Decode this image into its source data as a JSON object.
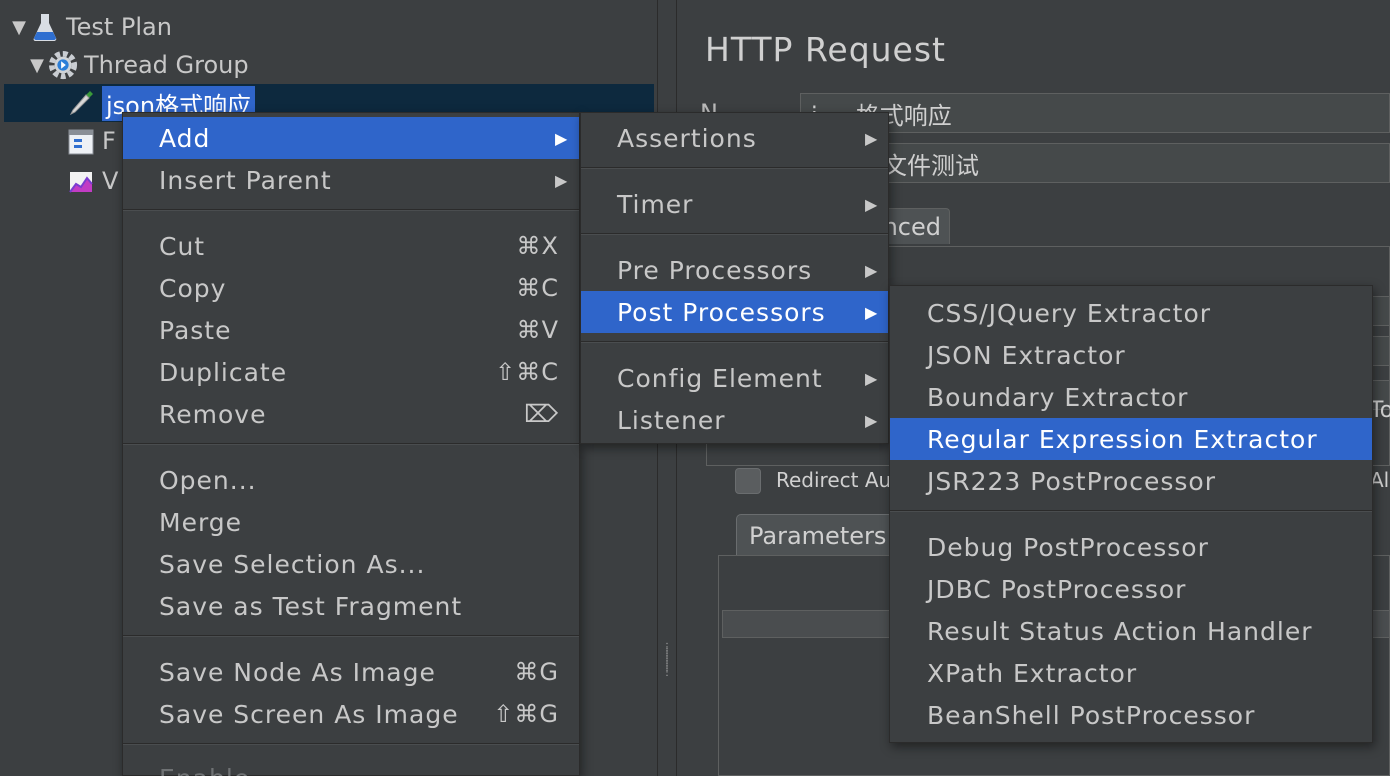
{
  "tree": {
    "test_plan": "Test Plan",
    "thread_group": "Thread Group",
    "selected_item": "json格式响应",
    "hidden_item_1": "F",
    "hidden_item_2": "V"
  },
  "http_request": {
    "title": "HTTP Request",
    "name_label": "N",
    "name_value": "j     格式响应",
    "comments_value": "取本地文件测试",
    "tab_advanced": "nced",
    "redirect_label": "Redirect Au",
    "keepalive_partial": "Ali",
    "to_partial": "To",
    "tab_parameters": "Parameters"
  },
  "context_menu": {
    "add": "Add",
    "insert_parent": "Insert Parent",
    "cut": "Cut",
    "cut_sc": "⌘X",
    "copy": "Copy",
    "copy_sc": "⌘C",
    "paste": "Paste",
    "paste_sc": "⌘V",
    "duplicate": "Duplicate",
    "duplicate_sc": "⇧⌘C",
    "remove": "Remove",
    "remove_sc": "⌦",
    "open": "Open...",
    "merge": "Merge",
    "save_selection_as": "Save Selection As...",
    "save_as_test_fragment": "Save as Test Fragment",
    "save_node_as_image": "Save Node As Image",
    "save_node_sc": "⌘G",
    "save_screen_as_image": "Save Screen As Image",
    "save_screen_sc": "⇧⌘G",
    "enable": "Enable"
  },
  "add_menu": {
    "assertions": "Assertions",
    "timer": "Timer",
    "pre_processors": "Pre Processors",
    "post_processors": "Post Processors",
    "config_element": "Config Element",
    "listener": "Listener"
  },
  "post_menu": {
    "css_jquery": "CSS/JQuery Extractor",
    "json": "JSON Extractor",
    "boundary": "Boundary Extractor",
    "regex": "Regular Expression Extractor",
    "jsr223": "JSR223 PostProcessor",
    "debug": "Debug PostProcessor",
    "jdbc": "JDBC PostProcessor",
    "result_status": "Result Status Action Handler",
    "xpath": "XPath Extractor",
    "beanshell": "BeanShell PostProcessor"
  },
  "colors": {
    "background": "#3c3f41",
    "highlight": "#2f65ca",
    "selection_row": "#0d293e",
    "text": "#c8c8c8"
  }
}
